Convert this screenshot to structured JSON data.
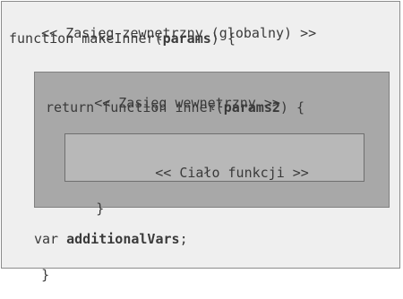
{
  "outer": {
    "comment": "<< Zasięg zewnętrzny (globalny) >>",
    "fn_prefix": "function makeInner(",
    "fn_param": "params",
    "fn_suffix": ") {",
    "var_keyword": "var ",
    "var_name": "additionalVars",
    "var_suffix": ";",
    "close_brace": "}"
  },
  "middle": {
    "comment": "<< Zasięg wewnętrzny >>",
    "ret_prefix": "return function inner(",
    "ret_param": "params2",
    "ret_suffix": ") {",
    "close_brace": "}"
  },
  "inner": {
    "comment": "<< Ciało funkcji >>"
  },
  "colors": {
    "outer_bg": "#efefef",
    "middle_bg": "#a8a8a8",
    "inner_bg": "#b8b8b8",
    "text": "#3a3a3a"
  }
}
